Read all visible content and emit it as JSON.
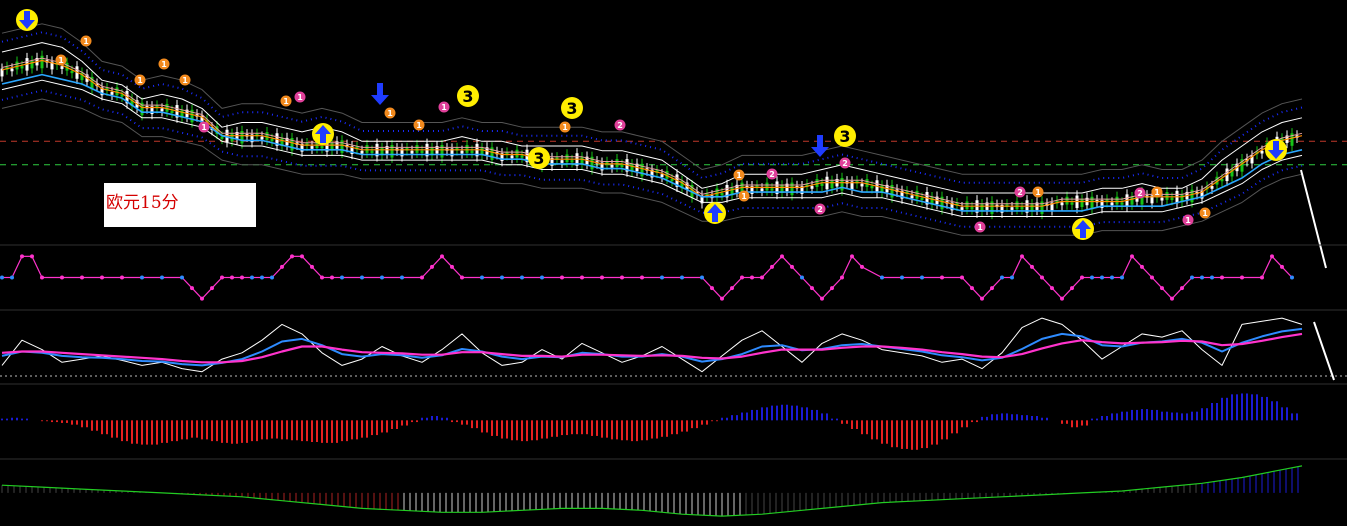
{
  "label": {
    "text": "欧元15分"
  },
  "colors": {
    "background": "#000000",
    "candle_up": "#ffffff",
    "candle_down": "#16c416",
    "upper_band": "#ffffff",
    "band_dots": "#1a2cff",
    "ma_fast": "#ff8c00",
    "ma_mid": "#e8a0a0",
    "ma_slow": "#2aa7ff",
    "hline_red": "#c0392b",
    "hline_green": "#2ecc40",
    "stoch_k": "#ffffff",
    "stoch_blue": "#2e8bff",
    "stoch_pink": "#ff33cc",
    "hist_pos": "#1b1bd6",
    "hist_neg": "#e62020",
    "osc_line": "#22cc22",
    "signal_yellow": "#ffee00",
    "arrow_blue": "#1f3cff",
    "signal_pink": "#e0409a",
    "signal_orange": "#f28a1e"
  },
  "chart_data": [
    {
      "type": "line",
      "name": "price",
      "x": [
        0,
        20,
        40,
        60,
        80,
        100,
        120,
        140,
        160,
        180,
        200,
        220,
        240,
        260,
        280,
        300,
        320,
        340,
        360,
        380,
        400,
        420,
        440,
        460,
        480,
        500,
        520,
        540,
        560,
        580,
        600,
        620,
        640,
        660,
        680,
        700,
        720,
        740,
        760,
        780,
        800,
        820,
        840,
        860,
        880,
        900,
        920,
        940,
        960,
        980,
        1000,
        1020,
        1040,
        1060,
        1080,
        1100,
        1120,
        1140,
        1160,
        1180,
        1200,
        1220,
        1240,
        1260,
        1280,
        1300
      ],
      "series": [
        {
          "values": [
            70,
            71,
            72,
            71,
            68,
            64,
            63,
            60,
            61,
            60,
            58,
            54,
            55,
            55,
            54,
            53,
            54,
            53,
            51,
            51,
            51,
            51,
            51,
            52,
            51,
            51,
            50,
            50,
            50,
            50,
            49,
            49,
            48,
            47,
            44,
            41,
            42,
            44,
            44,
            44,
            44,
            45,
            46,
            45,
            44,
            43,
            42,
            41,
            40,
            40,
            40,
            40,
            40,
            40,
            40,
            41,
            41,
            42,
            41,
            41,
            43,
            47,
            50,
            53,
            55,
            56
          ]
        },
        {
          "values": [
            66,
            67,
            68,
            67,
            65,
            62,
            61,
            58,
            58,
            57,
            56,
            52,
            52,
            52,
            51,
            50,
            50,
            50,
            49,
            49,
            49,
            49,
            49,
            49,
            49,
            48,
            48,
            47,
            47,
            47,
            46,
            46,
            45,
            44,
            42,
            39,
            40,
            41,
            41,
            41,
            41,
            42,
            42,
            42,
            41,
            40,
            39,
            38,
            37,
            37,
            37,
            37,
            37,
            38,
            38,
            38,
            38,
            39,
            39,
            39,
            40,
            43,
            46,
            49,
            51,
            52
          ]
        },
        {
          "values": [
            62,
            63,
            64,
            63,
            62,
            60,
            59,
            56,
            56,
            55,
            54,
            51,
            50,
            50,
            49,
            48,
            48,
            48,
            47,
            47,
            47,
            47,
            47,
            47,
            47,
            46,
            46,
            45,
            45,
            45,
            44,
            44,
            43,
            42,
            40,
            38,
            38,
            39,
            39,
            39,
            39,
            39,
            40,
            39,
            39,
            38,
            37,
            36,
            35,
            35,
            35,
            35,
            35,
            35,
            35,
            36,
            36,
            36,
            36,
            37,
            38,
            40,
            42,
            45,
            47,
            48
          ]
        }
      ],
      "ylim": [
        30,
        80
      ],
      "hlines": [
        51,
        46
      ]
    },
    {
      "type": "line",
      "name": "stepped-oscillator",
      "x": [
        0,
        10,
        20,
        30,
        40,
        60,
        80,
        100,
        120,
        140,
        160,
        180,
        190,
        200,
        210,
        220,
        230,
        240,
        250,
        260,
        270,
        280,
        290,
        300,
        310,
        320,
        330,
        340,
        360,
        380,
        400,
        420,
        430,
        440,
        450,
        460,
        480,
        500,
        520,
        540,
        560,
        580,
        600,
        620,
        640,
        660,
        680,
        700,
        710,
        720,
        730,
        740,
        750,
        760,
        770,
        780,
        790,
        800,
        810,
        820,
        830,
        840,
        850,
        860,
        880,
        900,
        920,
        940,
        960,
        970,
        980,
        990,
        1000,
        1010,
        1020,
        1030,
        1040,
        1050,
        1060,
        1070,
        1080,
        1090,
        1100,
        1110,
        1120,
        1130,
        1140,
        1150,
        1160,
        1170,
        1180,
        1190,
        1200,
        1210,
        1220,
        1240,
        1260,
        1270,
        1280,
        1290
      ],
      "values": [
        0,
        0,
        1,
        1,
        0,
        0,
        0,
        0,
        0,
        0,
        0,
        0,
        -0.5,
        -1,
        -0.5,
        0,
        0,
        0,
        0,
        0,
        0,
        0.5,
        1,
        1,
        0.5,
        0,
        0,
        0,
        0,
        0,
        0,
        0,
        0.5,
        1,
        0.5,
        0,
        0,
        0,
        0,
        0,
        0,
        0,
        0,
        0,
        0,
        0,
        0,
        0,
        -0.5,
        -1,
        -0.5,
        0,
        0,
        0,
        0.5,
        1,
        0.5,
        0,
        -0.5,
        -1,
        -0.5,
        0,
        1,
        0.5,
        0,
        0,
        0,
        0,
        0,
        -0.5,
        -1,
        -0.5,
        0,
        0,
        1,
        0.5,
        0,
        -0.5,
        -1,
        -0.5,
        0,
        0,
        0,
        0,
        0,
        1,
        0.5,
        0,
        -0.5,
        -1,
        -0.5,
        0,
        0,
        0,
        0,
        0,
        0,
        1,
        0.5,
        0
      ],
      "ylim": [
        -1.3,
        1.3
      ]
    },
    {
      "type": "line",
      "name": "stochastic",
      "x": [
        0,
        20,
        40,
        60,
        80,
        100,
        120,
        140,
        160,
        180,
        200,
        220,
        240,
        260,
        280,
        300,
        320,
        340,
        360,
        380,
        400,
        420,
        440,
        460,
        480,
        500,
        520,
        540,
        560,
        580,
        600,
        620,
        640,
        660,
        680,
        700,
        720,
        740,
        760,
        780,
        800,
        820,
        840,
        860,
        880,
        900,
        920,
        940,
        960,
        980,
        1000,
        1020,
        1040,
        1060,
        1080,
        1100,
        1120,
        1140,
        1160,
        1180,
        1200,
        1220,
        1240,
        1260,
        1280,
        1300
      ],
      "series": [
        {
          "values": [
            20,
            60,
            45,
            25,
            30,
            35,
            28,
            20,
            25,
            15,
            10,
            30,
            40,
            60,
            85,
            70,
            40,
            20,
            30,
            50,
            35,
            25,
            45,
            70,
            40,
            20,
            25,
            45,
            30,
            55,
            40,
            25,
            35,
            50,
            30,
            10,
            35,
            60,
            75,
            50,
            25,
            55,
            70,
            60,
            45,
            40,
            35,
            25,
            30,
            15,
            40,
            80,
            95,
            85,
            60,
            30,
            50,
            70,
            65,
            75,
            45,
            20,
            85,
            90,
            95,
            85
          ]
        },
        {
          "values": [
            35,
            42,
            40,
            35,
            33,
            32,
            30,
            27,
            26,
            22,
            20,
            24,
            30,
            42,
            58,
            62,
            52,
            38,
            34,
            38,
            36,
            32,
            36,
            46,
            42,
            34,
            30,
            34,
            33,
            40,
            38,
            34,
            34,
            38,
            34,
            26,
            30,
            38,
            50,
            52,
            44,
            46,
            52,
            54,
            50,
            46,
            42,
            36,
            33,
            28,
            32,
            46,
            62,
            70,
            66,
            52,
            50,
            56,
            58,
            62,
            56,
            42,
            56,
            66,
            74,
            78
          ]
        },
        {
          "values": [
            40,
            42,
            42,
            40,
            38,
            36,
            34,
            32,
            30,
            27,
            25,
            25,
            27,
            33,
            42,
            50,
            50,
            45,
            41,
            40,
            39,
            37,
            37,
            41,
            41,
            38,
            35,
            35,
            34,
            37,
            37,
            36,
            35,
            36,
            35,
            32,
            31,
            34,
            40,
            45,
            45,
            45,
            48,
            50,
            50,
            48,
            45,
            41,
            38,
            34,
            33,
            38,
            47,
            55,
            60,
            57,
            55,
            56,
            57,
            59,
            58,
            52,
            54,
            59,
            65,
            70
          ]
        }
      ],
      "ylim": [
        0,
        100
      ]
    },
    {
      "type": "bar",
      "name": "histogram",
      "x": [
        0,
        10,
        20,
        30,
        40,
        50,
        60,
        70,
        80,
        90,
        100,
        110,
        120,
        130,
        140,
        150,
        160,
        170,
        180,
        190,
        200,
        210,
        220,
        230,
        240,
        250,
        260,
        270,
        280,
        290,
        300,
        310,
        320,
        330,
        340,
        350,
        360,
        370,
        380,
        390,
        400,
        410,
        420,
        430,
        440,
        450,
        460,
        470,
        480,
        490,
        500,
        510,
        520,
        530,
        540,
        550,
        560,
        570,
        580,
        590,
        600,
        610,
        620,
        630,
        640,
        650,
        660,
        670,
        680,
        690,
        700,
        710,
        720,
        730,
        740,
        750,
        760,
        770,
        780,
        790,
        800,
        810,
        820,
        830,
        840,
        850,
        860,
        870,
        880,
        890,
        900,
        910,
        920,
        930,
        940,
        950,
        960,
        970,
        980,
        990,
        1000,
        1010,
        1020,
        1030,
        1040,
        1050,
        1060,
        1070,
        1080,
        1090,
        1100,
        1110,
        1120,
        1130,
        1140,
        1150,
        1160,
        1170,
        1180,
        1190,
        1200,
        1210,
        1220,
        1230,
        1240,
        1250,
        1260,
        1270,
        1280,
        1290
      ],
      "values": [
        2,
        3,
        2,
        0,
        -1,
        -2,
        -3,
        -5,
        -8,
        -12,
        -16,
        -20,
        -24,
        -27,
        -28,
        -28,
        -26,
        -24,
        -22,
        -20,
        -22,
        -24,
        -26,
        -27,
        -26,
        -24,
        -22,
        -21,
        -22,
        -23,
        -24,
        -25,
        -26,
        -26,
        -24,
        -22,
        -20,
        -17,
        -14,
        -10,
        -6,
        -2,
        3,
        5,
        3,
        -2,
        -5,
        -9,
        -14,
        -18,
        -21,
        -23,
        -24,
        -23,
        -21,
        -19,
        -17,
        -16,
        -16,
        -18,
        -20,
        -22,
        -23,
        -24,
        -23,
        -21,
        -19,
        -16,
        -13,
        -9,
        -5,
        -1,
        3,
        6,
        9,
        12,
        15,
        17,
        18,
        17,
        15,
        12,
        8,
        2,
        -4,
        -10,
        -16,
        -22,
        -27,
        -31,
        -33,
        -34,
        -32,
        -28,
        -22,
        -15,
        -8,
        -2,
        4,
        7,
        8,
        7,
        6,
        5,
        3,
        0,
        -4,
        -8,
        -6,
        2,
        5,
        8,
        10,
        12,
        13,
        12,
        10,
        9,
        8,
        10,
        14,
        20,
        26,
        30,
        31,
        30,
        27,
        22,
        15,
        8
      ],
      "ylim": [
        -40,
        35
      ]
    },
    {
      "type": "line",
      "name": "oscillator-2",
      "x": [
        0,
        40,
        80,
        120,
        160,
        200,
        240,
        280,
        320,
        360,
        400,
        440,
        480,
        520,
        560,
        600,
        640,
        680,
        720,
        760,
        800,
        840,
        880,
        920,
        960,
        1000,
        1040,
        1080,
        1120,
        1160,
        1200,
        1240,
        1280,
        1300
      ],
      "values": [
        4,
        3,
        2,
        1,
        0,
        -1,
        -2,
        -4,
        -6,
        -8,
        -9,
        -10,
        -10,
        -9,
        -8,
        -8,
        -9,
        -11,
        -12,
        -11,
        -9,
        -7,
        -5,
        -4,
        -3,
        -2,
        -1,
        0,
        1,
        3,
        5,
        8,
        12,
        14
      ],
      "ylim": [
        -14,
        16
      ]
    }
  ],
  "signals": [
    {
      "kind": "arrow-down-yellow",
      "x": 27,
      "y": 20
    },
    {
      "kind": "arrow-up-yellow",
      "x": 323,
      "y": 134
    },
    {
      "kind": "arrow-up-yellow",
      "x": 715,
      "y": 213
    },
    {
      "kind": "arrow-up-yellow",
      "x": 1083,
      "y": 229
    },
    {
      "kind": "arrow-down-yellow",
      "x": 1276,
      "y": 150
    },
    {
      "kind": "arrow-down-blue",
      "x": 380,
      "y": 95
    },
    {
      "kind": "arrow-down-blue",
      "x": 820,
      "y": 147
    },
    {
      "kind": "num-yellow",
      "label": "3",
      "x": 468,
      "y": 96
    },
    {
      "kind": "num-yellow",
      "label": "3",
      "x": 572,
      "y": 108
    },
    {
      "kind": "num-yellow",
      "label": "3",
      "x": 539,
      "y": 158
    },
    {
      "kind": "num-yellow",
      "label": "3",
      "x": 845,
      "y": 136
    },
    {
      "kind": "num-orange",
      "label": "1",
      "x": 86,
      "y": 41
    },
    {
      "kind": "num-orange",
      "label": "1",
      "x": 61,
      "y": 60
    },
    {
      "kind": "num-orange",
      "label": "1",
      "x": 164,
      "y": 64
    },
    {
      "kind": "num-orange",
      "label": "1",
      "x": 140,
      "y": 80
    },
    {
      "kind": "num-orange",
      "label": "1",
      "x": 185,
      "y": 80
    },
    {
      "kind": "num-orange",
      "label": "1",
      "x": 286,
      "y": 101
    },
    {
      "kind": "num-orange",
      "label": "1",
      "x": 390,
      "y": 113
    },
    {
      "kind": "num-orange",
      "label": "1",
      "x": 419,
      "y": 125
    },
    {
      "kind": "num-orange",
      "label": "1",
      "x": 565,
      "y": 127
    },
    {
      "kind": "num-orange",
      "label": "1",
      "x": 739,
      "y": 175
    },
    {
      "kind": "num-orange",
      "label": "1",
      "x": 744,
      "y": 196
    },
    {
      "kind": "num-orange",
      "label": "1",
      "x": 1038,
      "y": 192
    },
    {
      "kind": "num-orange",
      "label": "1",
      "x": 1157,
      "y": 192
    },
    {
      "kind": "num-orange",
      "label": "1",
      "x": 1205,
      "y": 213
    },
    {
      "kind": "num-pink",
      "label": "1",
      "x": 204,
      "y": 127
    },
    {
      "kind": "num-pink",
      "label": "1",
      "x": 300,
      "y": 97
    },
    {
      "kind": "num-pink",
      "label": "1",
      "x": 444,
      "y": 107
    },
    {
      "kind": "num-pink",
      "label": "2",
      "x": 620,
      "y": 125
    },
    {
      "kind": "num-pink",
      "label": "2",
      "x": 772,
      "y": 174
    },
    {
      "kind": "num-pink",
      "label": "2",
      "x": 845,
      "y": 163
    },
    {
      "kind": "num-pink",
      "label": "2",
      "x": 820,
      "y": 209
    },
    {
      "kind": "num-pink",
      "label": "2",
      "x": 1020,
      "y": 192
    },
    {
      "kind": "num-pink",
      "label": "2",
      "x": 1140,
      "y": 193
    },
    {
      "kind": "num-pink",
      "label": "1",
      "x": 980,
      "y": 227
    },
    {
      "kind": "num-pink",
      "label": "1",
      "x": 1188,
      "y": 220
    }
  ]
}
